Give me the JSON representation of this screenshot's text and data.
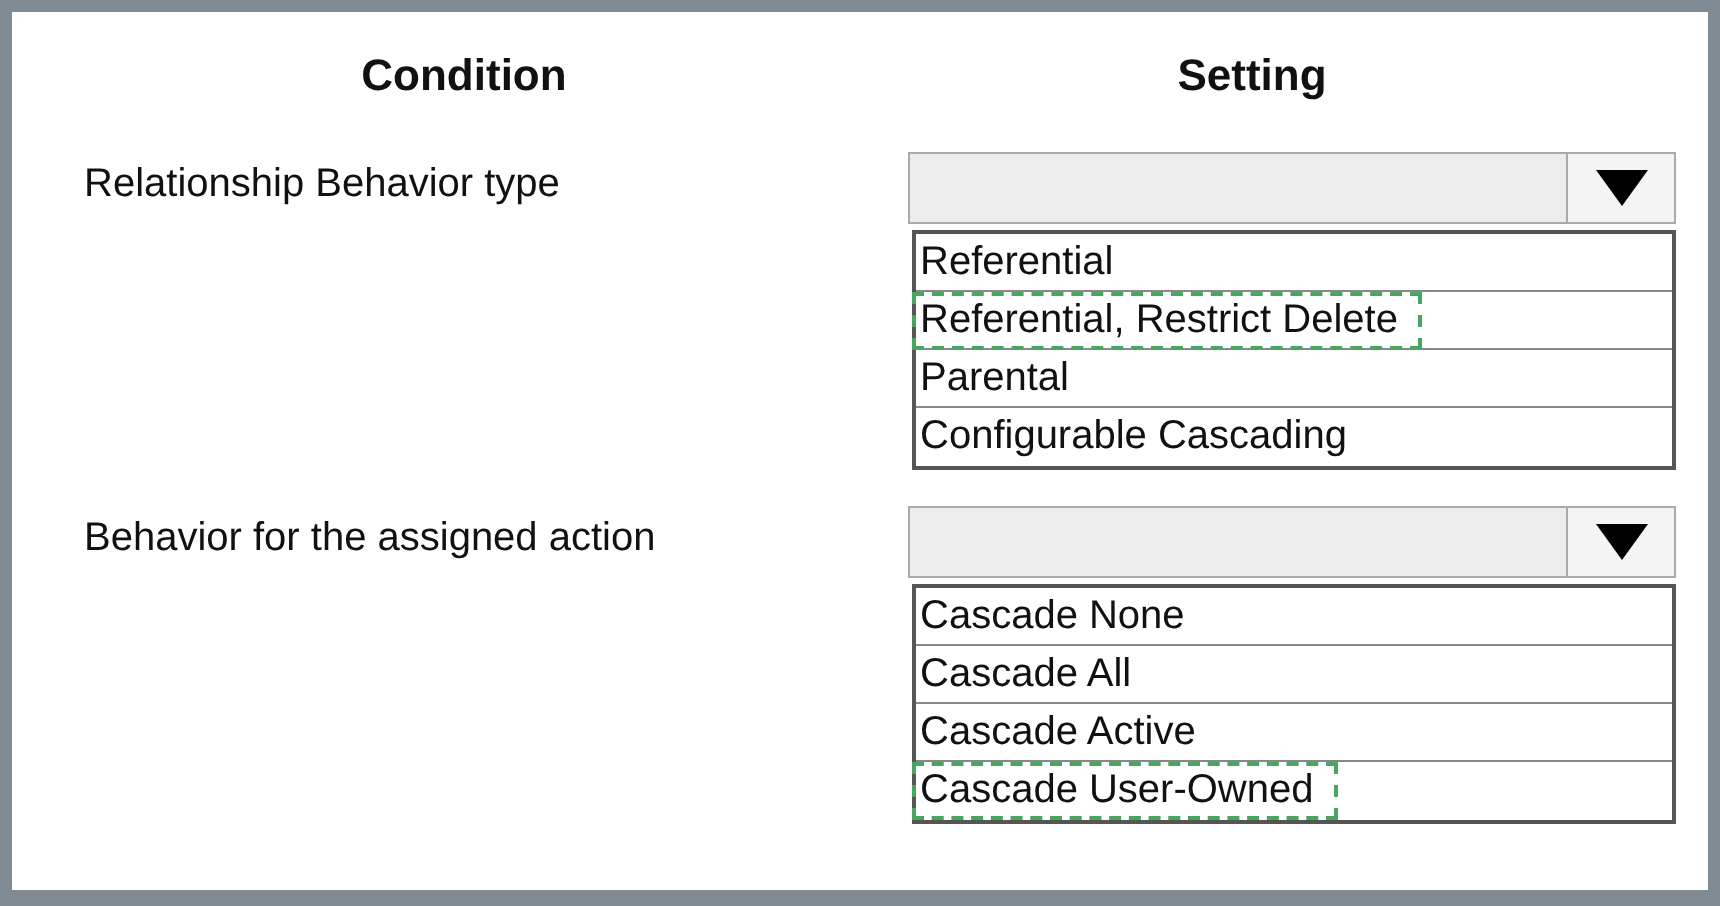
{
  "headers": {
    "condition": "Condition",
    "setting": "Setting"
  },
  "rows": [
    {
      "label": "Relationship Behavior type",
      "options": [
        {
          "text": "Referential",
          "selected": false
        },
        {
          "text": "Referential, Restrict Delete",
          "selected": true
        },
        {
          "text": "Parental",
          "selected": false
        },
        {
          "text": "Configurable Cascading",
          "selected": false
        }
      ]
    },
    {
      "label": "Behavior for the assigned action",
      "options": [
        {
          "text": "Cascade None",
          "selected": false
        },
        {
          "text": "Cascade All",
          "selected": false
        },
        {
          "text": "Cascade Active",
          "selected": false
        },
        {
          "text": "Cascade User-Owned",
          "selected": true
        }
      ]
    }
  ]
}
